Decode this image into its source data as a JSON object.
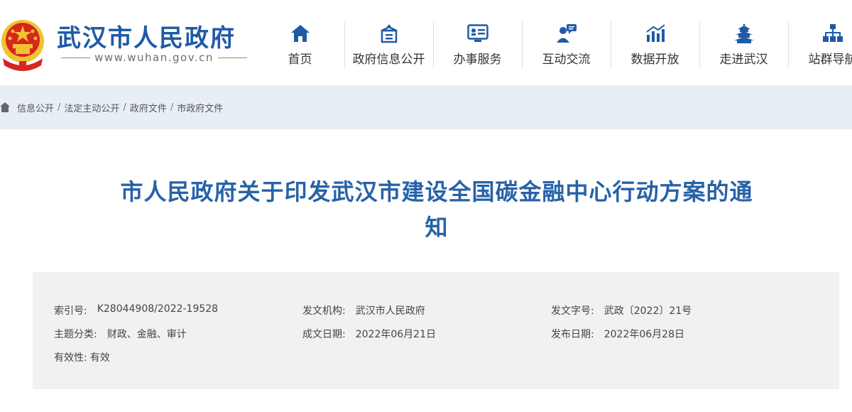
{
  "site": {
    "title": "武汉市人民政府",
    "url": "www.wuhan.gov.cn"
  },
  "nav": {
    "items": [
      {
        "label": "首页",
        "icon": "home-icon"
      },
      {
        "label": "政府信息公开",
        "icon": "government-building-icon"
      },
      {
        "label": "办事服务",
        "icon": "id-card-icon"
      },
      {
        "label": "互动交流",
        "icon": "chat-person-icon"
      },
      {
        "label": "数据开放",
        "icon": "bar-chart-icon"
      },
      {
        "label": "走进武汉",
        "icon": "yellow-crane-tower-icon"
      },
      {
        "label": "站群导航",
        "icon": "sitemap-icon"
      }
    ]
  },
  "breadcrumb": {
    "items": [
      "信息公开",
      "法定主动公开",
      "政府文件",
      "市政府文件"
    ],
    "separator": "/"
  },
  "document": {
    "title_line1": "市人民政府关于印发武汉市建设全国碳金融中心行动方案的通",
    "title_line2": "知"
  },
  "meta": {
    "index_no": {
      "label": "索引号:",
      "value": "K28044908/2022-19528"
    },
    "issuer": {
      "label": "发文机构:",
      "value": "武汉市人民政府"
    },
    "doc_no": {
      "label": "发文字号:",
      "value": "武政〔2022〕21号"
    },
    "topic": {
      "label": "主题分类:",
      "value": "财政、金融、审计"
    },
    "written_date": {
      "label": "成文日期:",
      "value": "2022年06月21日"
    },
    "publish_date": {
      "label": "发布日期:",
      "value": "2022年06月28日"
    },
    "validity": {
      "label": "有效性:",
      "value": "有效"
    }
  },
  "colors": {
    "brand_blue": "#1f5aa6",
    "title_blue": "#2762a8",
    "crumb_bg": "#e8eef5",
    "meta_bg": "#f1f1f1",
    "emblem_red": "#d7261e",
    "emblem_gold": "#f2c230"
  }
}
